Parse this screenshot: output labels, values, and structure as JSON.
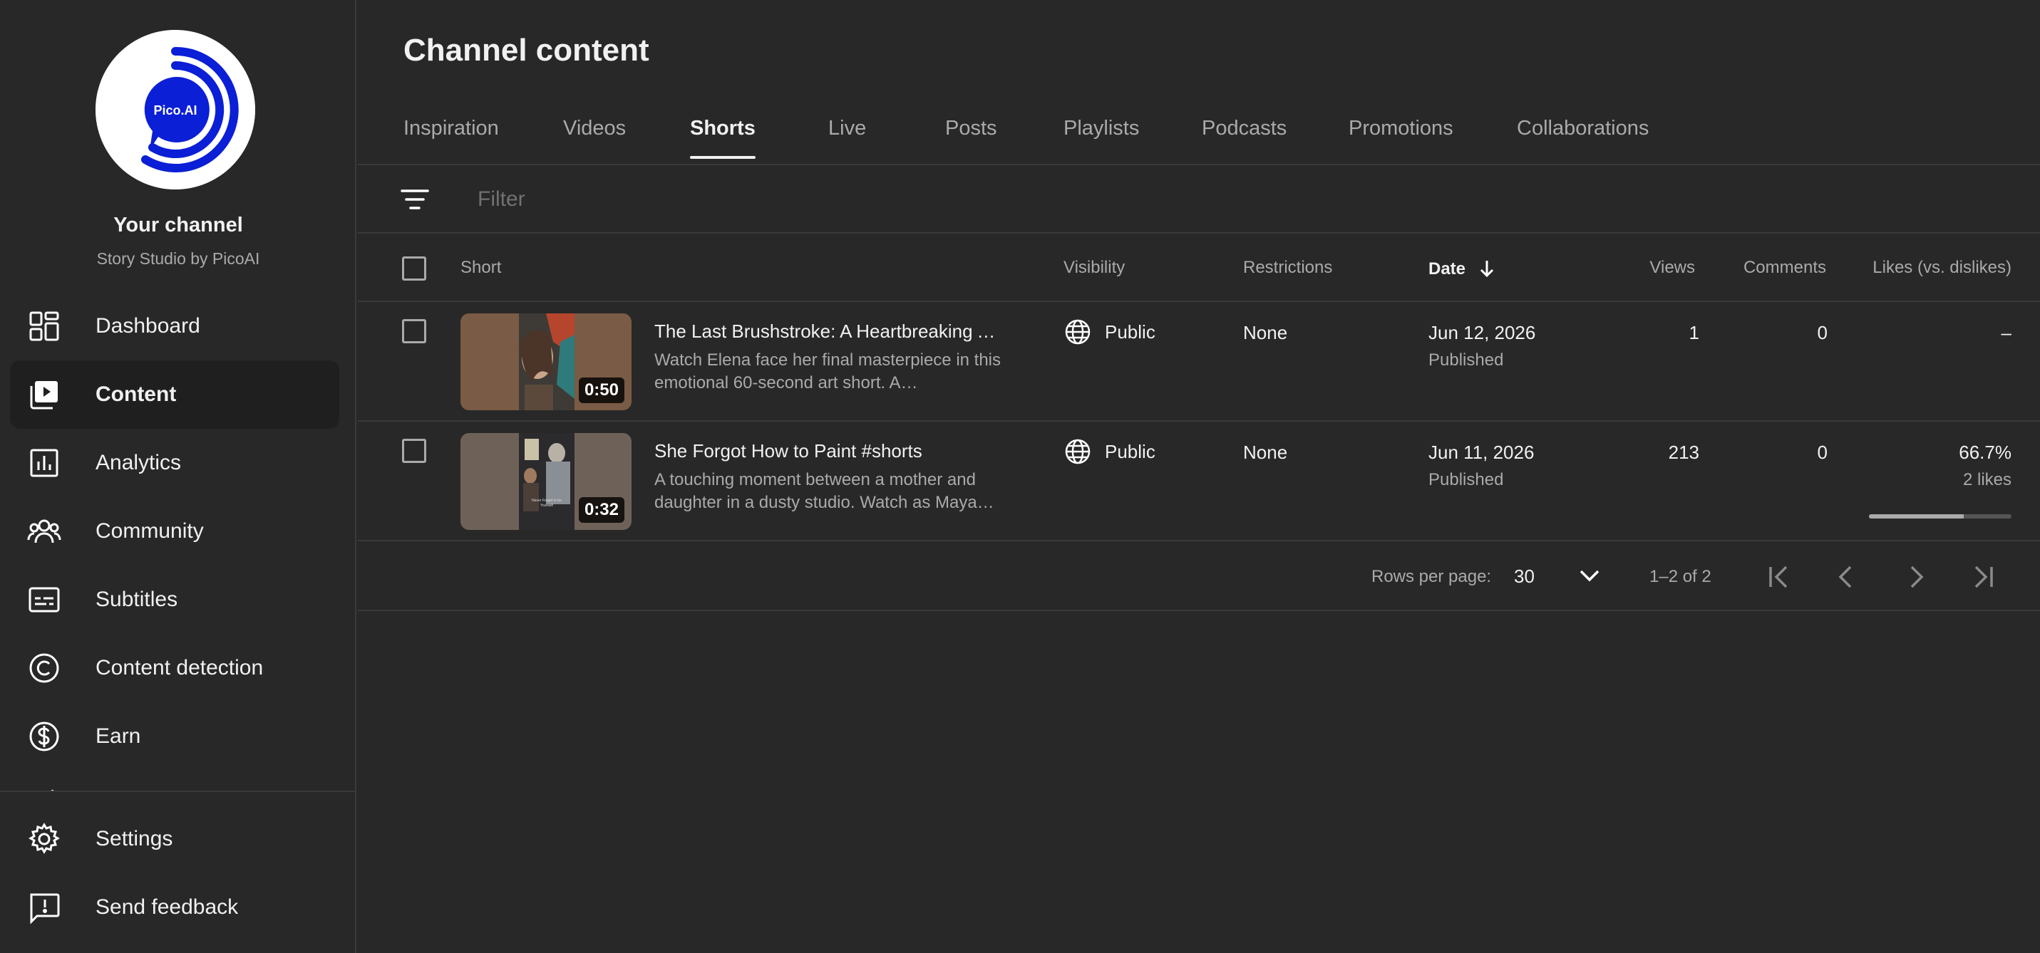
{
  "colors": {
    "accent": "#0b1fd6",
    "background": "#282828",
    "active_nav": "#1f1f1f"
  },
  "sidebar": {
    "avatar_text": "Pico.AI",
    "channel_title": "Your channel",
    "channel_name": "Story Studio by PicoAI",
    "items": [
      {
        "label": "Dashboard",
        "icon": "dashboard-icon"
      },
      {
        "label": "Content",
        "icon": "content-icon",
        "active": true
      },
      {
        "label": "Analytics",
        "icon": "analytics-icon"
      },
      {
        "label": "Community",
        "icon": "community-icon"
      },
      {
        "label": "Subtitles",
        "icon": "subtitles-icon"
      },
      {
        "label": "Content detection",
        "icon": "copyright-icon"
      },
      {
        "label": "Earn",
        "icon": "dollar-icon"
      }
    ],
    "bottom_items": [
      {
        "label": "Settings",
        "icon": "gear-icon"
      },
      {
        "label": "Send feedback",
        "icon": "feedback-icon"
      }
    ]
  },
  "main": {
    "title": "Channel content",
    "tabs": [
      {
        "label": "Inspiration"
      },
      {
        "label": "Videos"
      },
      {
        "label": "Shorts",
        "active": true
      },
      {
        "label": "Live"
      },
      {
        "label": "Posts"
      },
      {
        "label": "Playlists"
      },
      {
        "label": "Podcasts"
      },
      {
        "label": "Promotions"
      },
      {
        "label": "Collaborations"
      }
    ],
    "filter_placeholder": "Filter",
    "columns": {
      "short": "Short",
      "visibility": "Visibility",
      "restrictions": "Restrictions",
      "date": "Date",
      "views": "Views",
      "comments": "Comments",
      "likes": "Likes (vs. dislikes)"
    },
    "rows": [
      {
        "title": "The Last Brushstroke: A Heartbreaking A…",
        "description": "Watch Elena face her final masterpiece in this emotional 60-second art short. A…",
        "duration": "0:50",
        "visibility": "Public",
        "restrictions": "None",
        "date": "Jun 12, 2026",
        "status": "Published",
        "views": "1",
        "comments": "0",
        "likes": "–",
        "likes_sub": ""
      },
      {
        "title": "She Forgot How to Paint #shorts",
        "description": "A touching moment between a mother and daughter in a dusty studio. Watch as Maya…",
        "duration": "0:32",
        "visibility": "Public",
        "restrictions": "None",
        "date": "Jun 11, 2026",
        "status": "Published",
        "views": "213",
        "comments": "0",
        "likes": "66.7%",
        "likes_sub": "2 likes",
        "likes_ratio": 0.667
      }
    ],
    "pagination": {
      "rows_per_page_label": "Rows per page:",
      "rows_per_page": "30",
      "range": "1–2 of 2"
    }
  }
}
